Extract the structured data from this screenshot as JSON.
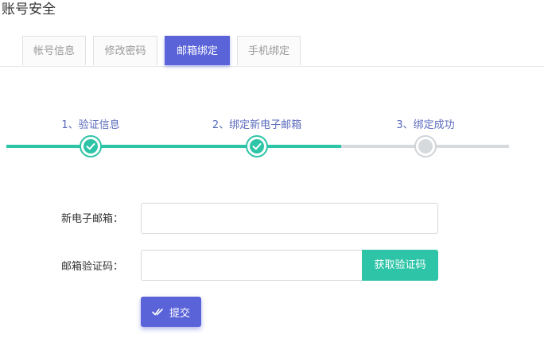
{
  "page": {
    "title": "账号安全"
  },
  "tabs": [
    {
      "label": "帐号信息",
      "active": false
    },
    {
      "label": "修改密码",
      "active": false
    },
    {
      "label": "邮箱绑定",
      "active": true
    },
    {
      "label": "手机绑定",
      "active": false
    }
  ],
  "steps": [
    {
      "label": "1、验证信息",
      "status": "done"
    },
    {
      "label": "2、绑定新电子邮箱",
      "status": "done"
    },
    {
      "label": "3、绑定成功",
      "status": "pending"
    }
  ],
  "form": {
    "email_label": "新电子邮箱：",
    "email_value": "",
    "code_label": "邮箱验证码：",
    "code_value": "",
    "get_code_label": "获取验证码",
    "submit_label": "提交"
  },
  "colors": {
    "primary": "#5a63d8",
    "success": "#2ec4a7",
    "pending": "#d6dadd"
  },
  "icons": {
    "step_done": "check-icon",
    "step_pending": "dot-icon",
    "submit": "double-check-icon"
  }
}
